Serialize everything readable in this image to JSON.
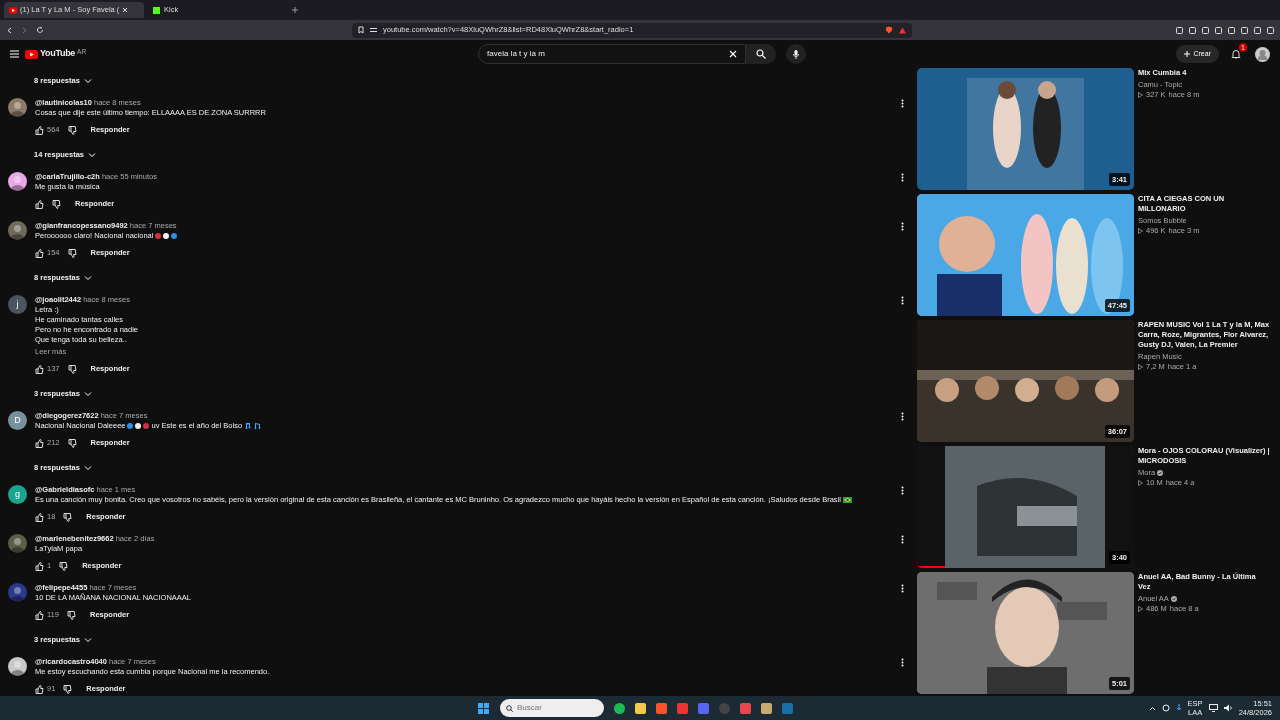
{
  "browser": {
    "tabs": [
      {
        "title": "(1) La T y La M - Soy Favela (",
        "selected": true
      },
      {
        "title": "Kick",
        "selected": false
      }
    ],
    "url": "youtube.com/watch?v=48XluQWhrZ8&list=RD48XluQWhrZ8&start_radio=1"
  },
  "header": {
    "logo": "YouTube",
    "country": "AR",
    "search": {
      "value": "favela la t y la m"
    },
    "create": "Crear",
    "notifications": "1"
  },
  "comments": [
    {
      "kind": "replies",
      "label": "8 respuestas"
    },
    {
      "kind": "comment",
      "author": "@lautinicolas10",
      "time": "hace 8 meses",
      "avatar": {
        "kind": "picture",
        "color": "#8d7b68"
      },
      "lines": [
        "Cosas que dije este último tiempo: ELLAAAA ES DE ZONA SURRRR"
      ],
      "likes": "564",
      "reply": "Responder"
    },
    {
      "kind": "replies",
      "label": "14 respuestas"
    },
    {
      "kind": "comment",
      "author": "@carlaTrujillo-c2h",
      "time": "hace 55 minutos",
      "avatar": {
        "kind": "picture",
        "color": "#e9a8e6"
      },
      "lines": [
        "Me gusta la música"
      ],
      "reply": "Responder"
    },
    {
      "kind": "comment",
      "author": "@gianfrancopessano9492",
      "time": "hace 7 meses",
      "avatar": {
        "kind": "picture",
        "color": "#6f6a5e"
      },
      "lines": [
        "Peroooooo claro! Nacional nacional"
      ],
      "dots": [
        {
          "color": "#d32f3f"
        },
        {
          "color": "#f2f2f2"
        },
        {
          "color": "#2f8fe0"
        }
      ],
      "likes": "154",
      "reply": "Responder"
    },
    {
      "kind": "replies",
      "label": "8 respuestas"
    },
    {
      "kind": "comment",
      "author": "@joaolit2442",
      "time": "hace 8 meses",
      "avatar": {
        "kind": "letter",
        "letter": "j",
        "color": "#4b5560"
      },
      "lines": [
        "Letra :)",
        "He caminado tantas calles",
        "Pero no he encontrado a nadie",
        "Que tenga toda su belleza.."
      ],
      "more": "Leer más",
      "likes": "137",
      "reply": "Responder"
    },
    {
      "kind": "replies",
      "label": "3 respuestas"
    },
    {
      "kind": "comment",
      "author": "@diegogerez7622",
      "time": "hace 7 meses",
      "avatar": {
        "kind": "letter",
        "letter": "D",
        "color": "#78909c"
      },
      "lines": [
        "Nacional Nacional Daleeee"
      ],
      "dots": [
        {
          "color": "#2f8fe0"
        },
        {
          "color": "#f2f2f2"
        },
        {
          "color": "#d32f3f"
        }
      ],
      "after": "uv Este es el año del Bolso",
      "music": true,
      "likes": "212",
      "reply": "Responder"
    },
    {
      "kind": "replies",
      "label": "8 respuestas"
    },
    {
      "kind": "comment",
      "author": "@Gabrieldiasofc",
      "time": "hace 1 mes",
      "avatar": {
        "kind": "letter",
        "letter": "g",
        "color": "#1aa58f"
      },
      "lines": [
        "Es una canción muy bonita. Creo que vosotros no sabéis, pero la versión original de esta canción es Brasileña, el cantante es MC Bruninho. Os agradezco mucho que hayáis hecho la versión en Español de esta canción. ¡Saludos desde Brasil"
      ],
      "flag": true,
      "likes": "18",
      "reply": "Responder"
    },
    {
      "kind": "comment",
      "author": "@marlenebenitez9662",
      "time": "hace 2 días",
      "avatar": {
        "kind": "picture",
        "color": "#5a6048"
      },
      "lines": [
        "LaTylaM papa"
      ],
      "likes": "1",
      "reply": "Responder"
    },
    {
      "kind": "comment",
      "author": "@felipepe4455",
      "time": "hace 7 meses",
      "avatar": {
        "kind": "picture",
        "color": "#2a3a8a"
      },
      "lines": [
        "10 DE LA MAÑANA NACIONAL NACIONAAAL"
      ],
      "likes": "119",
      "reply": "Responder"
    },
    {
      "kind": "replies",
      "label": "3 respuestas"
    },
    {
      "kind": "comment",
      "author": "@ricardocastro4040",
      "time": "hace 7 meses",
      "avatar": {
        "kind": "picture",
        "color": "#c9c9c9"
      },
      "lines": [
        "Me estoy escuchando esta cumbia porque Nacional me la recomendo."
      ],
      "likes": "91",
      "reply": "Responder"
    }
  ],
  "videos": [
    {
      "title": "Mix Cumbia 4",
      "channel": "Camu - Topic",
      "views": "327 K",
      "age": "hace 8 m",
      "duration": "3:41",
      "thumb": {
        "kind": "picture"
      }
    },
    {
      "title": "CITA A CIEGAS CON UN MILLONARIO",
      "channel": "Somos Bubble",
      "views": "496 K",
      "age": "hace 3 m",
      "duration": "47:45",
      "thumb": {
        "kind": "picture"
      }
    },
    {
      "title": "RAPEN MUSIC Vol 1 La T y la M, Max Carra, Roze, Migrantes, Flor Alvarez, Gusty DJ, Valen, La Premier",
      "channel": "Rapen Music",
      "views": "7,2 M",
      "age": "hace 1 a",
      "duration": "36:07",
      "thumb": {
        "kind": "picture"
      }
    },
    {
      "title": "Mora - OJOS COLORAU (Visualizer) | MICRODOSIS",
      "channel": "Mora",
      "verified": true,
      "views": "10 M",
      "age": "hace 4 a",
      "duration": "3:40",
      "thumb": {
        "kind": "picture"
      },
      "level": 0.13
    },
    {
      "title": "Anuel AA, Bad Bunny - La Última Vez",
      "channel": "Anuel AA",
      "verified": true,
      "views": "486 M",
      "age": "hace 8 a",
      "duration": "5:01",
      "thumb": {
        "kind": "picture"
      }
    }
  ],
  "taskbar": {
    "search": {
      "placeholder": "Buscar"
    },
    "language": "ESP",
    "layout": "LAA",
    "time": "15:51",
    "date": "24/8/2026"
  }
}
